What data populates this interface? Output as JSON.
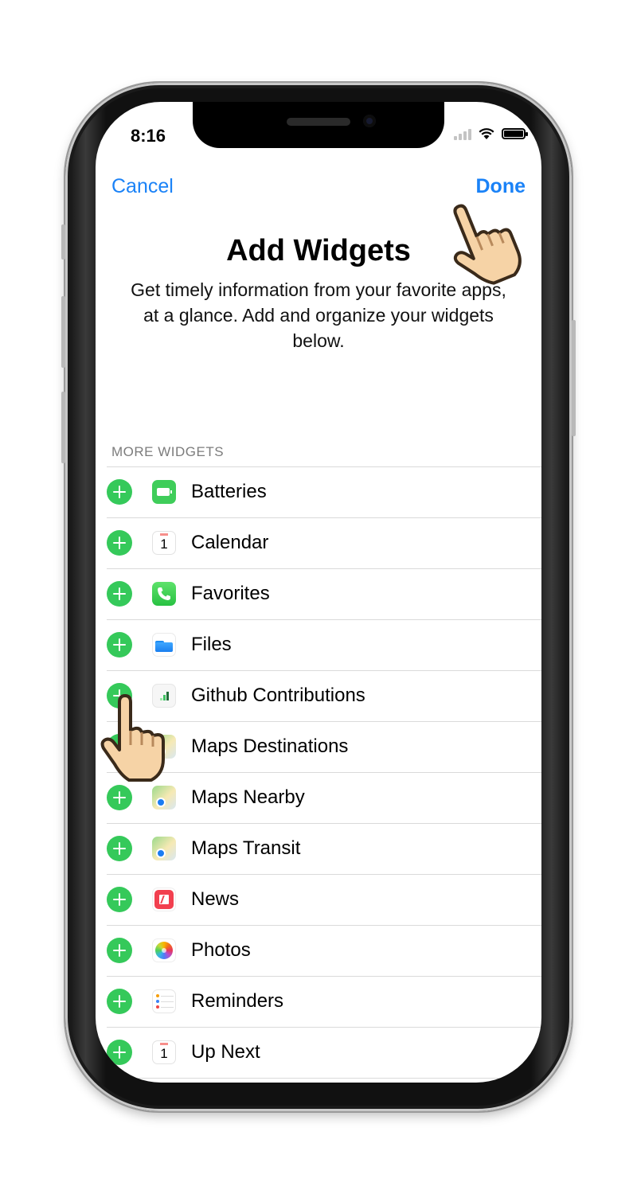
{
  "status_bar": {
    "time": "8:16"
  },
  "nav": {
    "cancel_label": "Cancel",
    "done_label": "Done"
  },
  "header": {
    "title": "Add Widgets",
    "subtitle": "Get timely information from your favorite apps, at a glance. Add and organize your widgets below."
  },
  "section": {
    "title": "MORE WIDGETS"
  },
  "widgets": [
    {
      "label": "Batteries",
      "icon": "batteries-icon"
    },
    {
      "label": "Calendar",
      "icon": "calendar-icon",
      "icon_day": "1"
    },
    {
      "label": "Favorites",
      "icon": "phone-icon"
    },
    {
      "label": "Files",
      "icon": "files-icon"
    },
    {
      "label": "Github Contributions",
      "icon": "github-contributions-icon"
    },
    {
      "label": "Maps Destinations",
      "icon": "maps-icon"
    },
    {
      "label": "Maps Nearby",
      "icon": "maps-icon"
    },
    {
      "label": "Maps Transit",
      "icon": "maps-icon"
    },
    {
      "label": "News",
      "icon": "news-icon"
    },
    {
      "label": "Photos",
      "icon": "photos-icon"
    },
    {
      "label": "Reminders",
      "icon": "reminders-icon"
    },
    {
      "label": "Up Next",
      "icon": "calendar-icon",
      "icon_day": "1"
    }
  ],
  "colors": {
    "accent": "#1a82f7",
    "add_green": "#35c95a"
  }
}
